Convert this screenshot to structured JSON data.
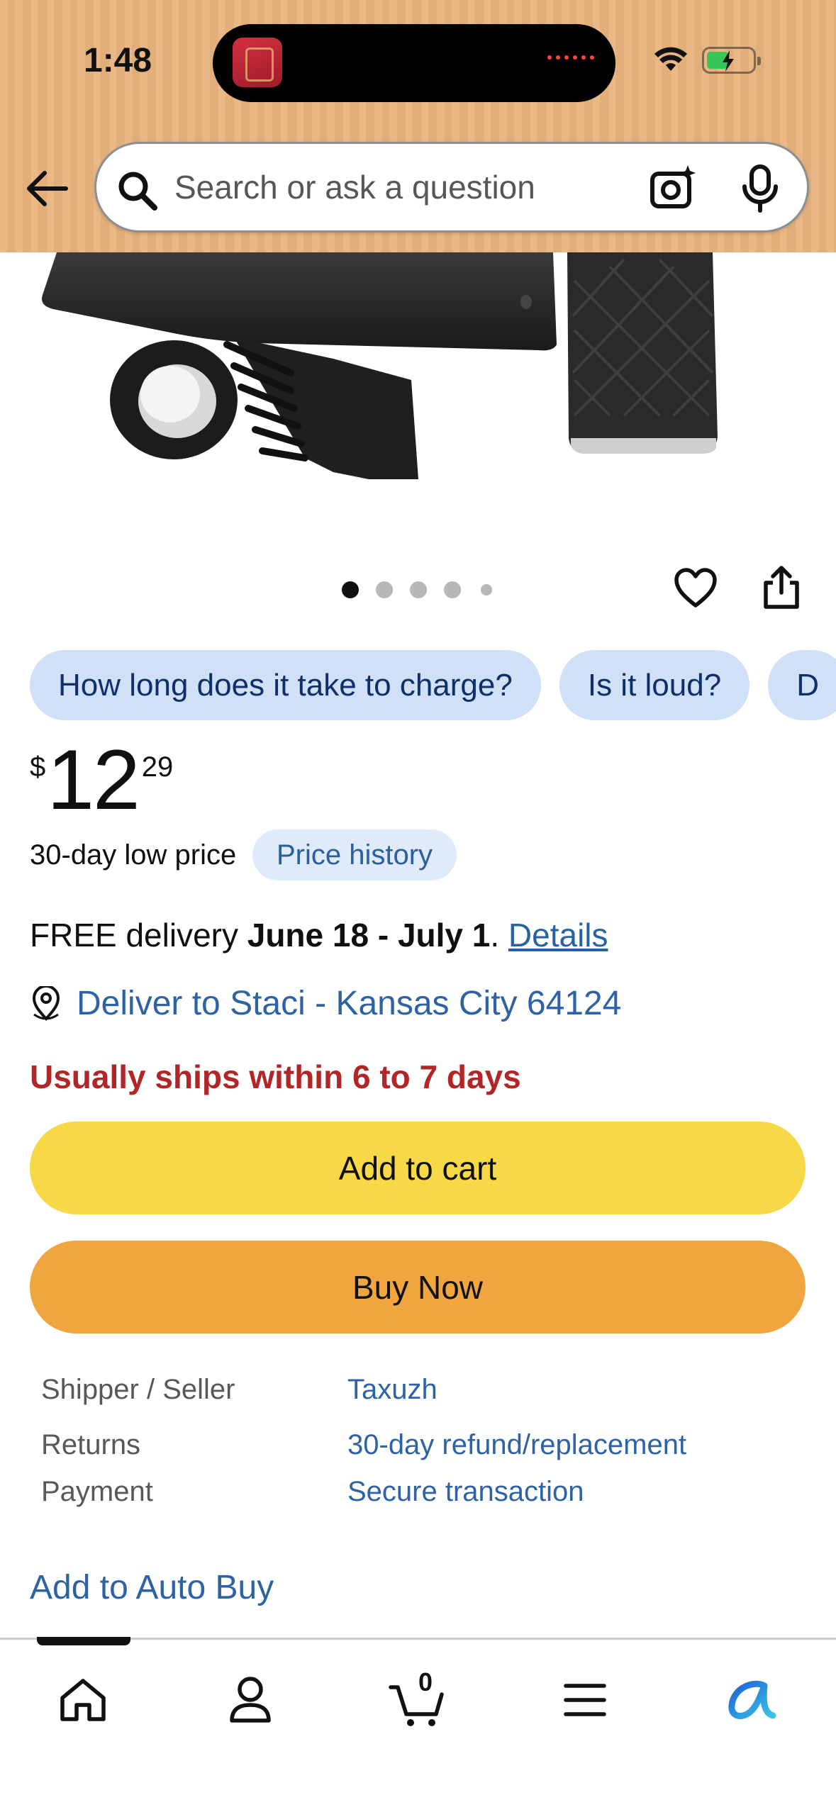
{
  "status_bar": {
    "time": "1:48"
  },
  "header": {
    "search": {
      "placeholder": "Search or ask a question"
    },
    "icons": [
      "back-arrow-icon",
      "search-icon",
      "camera-icon",
      "mic-icon"
    ]
  },
  "gallery": {
    "image_count": 5,
    "active_index": 0
  },
  "questions": [
    "How long does it take to charge?",
    "Is it loud?",
    "D"
  ],
  "price": {
    "currency": "$",
    "whole": "12",
    "fraction": "29",
    "low_price_label": "30-day low price",
    "history_label": "Price history"
  },
  "delivery": {
    "prefix": "FREE delivery",
    "dates": "June 18 - July 1",
    "suffix": ".",
    "details_link": "Details",
    "deliver_to": "Deliver to Staci - Kansas City 64124",
    "ships_notice": "Usually ships within 6 to 7 days"
  },
  "actions": {
    "add_to_cart": "Add to cart",
    "buy_now": "Buy Now"
  },
  "info": [
    {
      "label": "Shipper / Seller",
      "value": "Taxuzh"
    },
    {
      "label": "Returns",
      "value": "30-day refund/replacement"
    },
    {
      "label": "Payment",
      "value": "Secure transaction"
    }
  ],
  "auto_buy": "Add to Auto Buy",
  "bottom_nav": {
    "cart_count": "0",
    "items": [
      "home-icon",
      "account-icon",
      "cart-icon",
      "menu-icon",
      "rufus-ai-icon"
    ]
  },
  "colors": {
    "header_bg": "#e9b47e",
    "add_to_cart": "#f7d846",
    "buy_now": "#f0a53f",
    "link": "#2d63a4",
    "warning": "#b12727",
    "chip_bg": "#cfe0f7"
  }
}
